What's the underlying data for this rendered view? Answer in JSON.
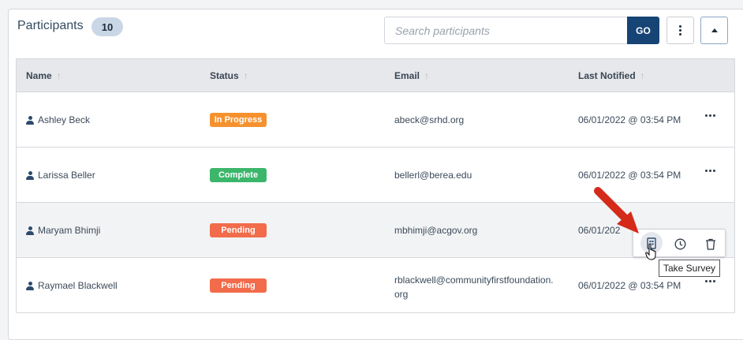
{
  "panel": {
    "title": "Participants",
    "count": "10"
  },
  "search": {
    "placeholder": "Search participants",
    "value": "",
    "go_label": "GO"
  },
  "icons": {
    "more": "kebab-vertical-icon",
    "collapse": "caret-up-icon",
    "row_more": "ellipsis-horizontal-icon",
    "survey": "clipboard-icon",
    "history": "clock-icon",
    "delete": "trash-icon",
    "person": "user-icon",
    "cursor": "hand-pointer-icon",
    "annotation": "red-arrow-icon"
  },
  "colors": {
    "primary": "#164475",
    "in_progress": "#f5922f",
    "complete": "#3cb66b",
    "pending": "#f26b4a",
    "annotation_arrow": "#d42a1a"
  },
  "table": {
    "columns": [
      "Name",
      "Status",
      "Email",
      "Last Notified"
    ],
    "sort_glyph": "↑",
    "rows": [
      {
        "name": "Ashley Beck",
        "status": "In Progress",
        "status_color": "#f5922f",
        "email": "abeck@srhd.org",
        "last_notified": "06/01/2022 @ 03:54 PM"
      },
      {
        "name": "Larissa Beller",
        "status": "Complete",
        "status_color": "#3cb66b",
        "email": "bellerl@berea.edu",
        "last_notified": "06/01/2022 @ 03:54 PM"
      },
      {
        "name": "Maryam Bhimji",
        "status": "Pending",
        "status_color": "#f26b4a",
        "email": "mbhimji@acgov.org",
        "last_notified": "06/01/202"
      },
      {
        "name": "Raymael Blackwell",
        "status": "Pending",
        "status_color": "#f26b4a",
        "email_line1": "rblackwell@communityfirstfoundation.",
        "email_line2": "org",
        "last_notified": "06/01/2022 @ 03:54 PM"
      }
    ]
  },
  "tooltip": {
    "text": "Take Survey"
  }
}
